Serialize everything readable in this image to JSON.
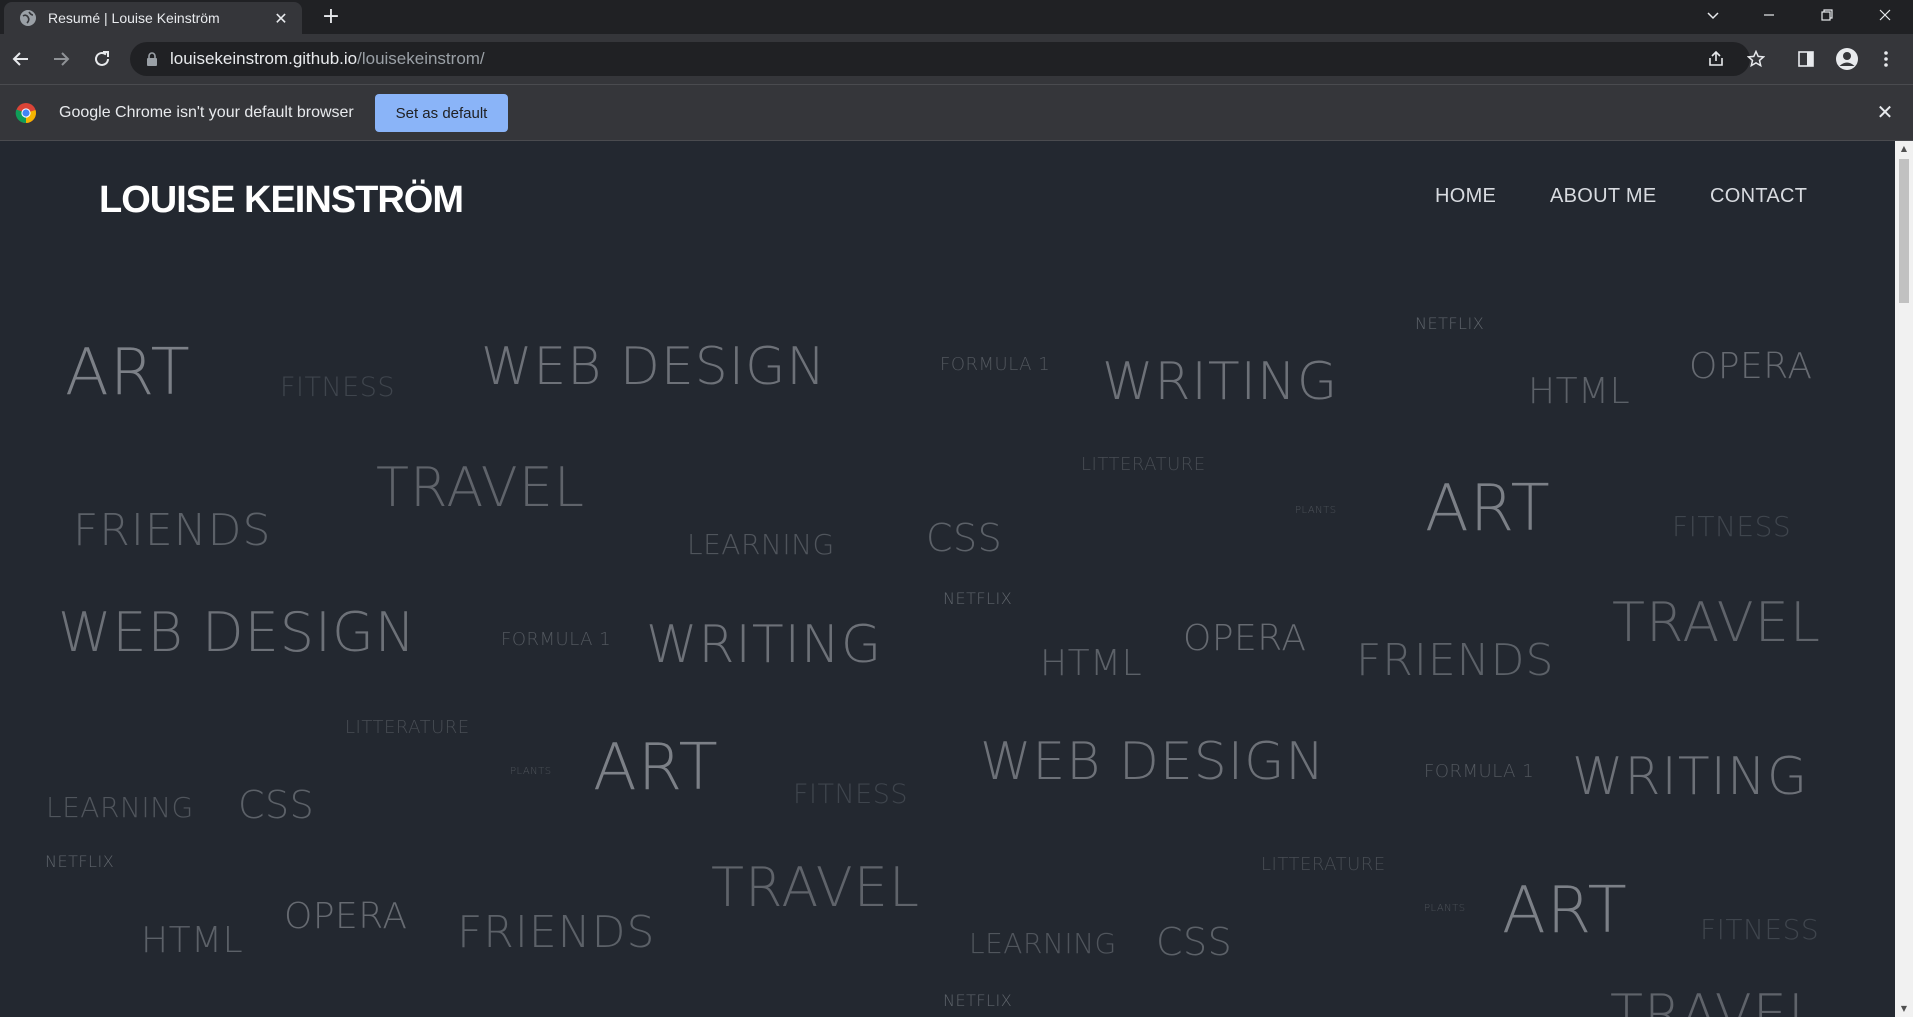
{
  "browser": {
    "tab_title": "Resumé | Louise Keinström",
    "url_host": "louisekeinstrom.github.io",
    "url_path": "/louisekeinstrom/"
  },
  "infobar": {
    "message": "Google Chrome isn't your default browser",
    "button_label": "Set as default"
  },
  "site": {
    "title": "LOUISE KEINSTRÖM",
    "nav": [
      "HOME",
      "ABOUT ME",
      "CONTACT"
    ]
  },
  "word_cloud": [
    {
      "text": "ART",
      "tone": "#7c8087"
    },
    {
      "text": "FITNESS",
      "tone": "#3f454d"
    },
    {
      "text": "WEB DESIGN",
      "tone": "#6d7178"
    },
    {
      "text": "FORMULA 1",
      "tone": "#52575e"
    },
    {
      "text": "WRITING",
      "tone": "#6d7178"
    },
    {
      "text": "NETFLIX",
      "tone": "#5f646b"
    },
    {
      "text": "OPERA",
      "tone": "#666a71"
    },
    {
      "text": "HTML",
      "tone": "#5c6168"
    },
    {
      "text": "TRAVEL",
      "tone": "#5f636a"
    },
    {
      "text": "LITTERATURE",
      "tone": "#484d54"
    },
    {
      "text": "FRIENDS",
      "tone": "#5c6168"
    },
    {
      "text": "LEARNING",
      "tone": "#50555c"
    },
    {
      "text": "CSS",
      "tone": "#5c6168"
    },
    {
      "text": "PLANTS",
      "tone": "#4d5259"
    },
    {
      "text": "ART",
      "tone": "#7c8087"
    },
    {
      "text": "FITNESS",
      "tone": "#3f454d"
    },
    {
      "text": "NETFLIX",
      "tone": "#5f646b"
    },
    {
      "text": "WEB DESIGN",
      "tone": "#6d7178"
    },
    {
      "text": "FORMULA 1",
      "tone": "#52575e"
    },
    {
      "text": "WRITING",
      "tone": "#6d7178"
    },
    {
      "text": "HTML",
      "tone": "#5c6168"
    },
    {
      "text": "OPERA",
      "tone": "#666a71"
    },
    {
      "text": "FRIENDS",
      "tone": "#5c6168"
    },
    {
      "text": "TRAVEL",
      "tone": "#5f636a"
    },
    {
      "text": "LITTERATURE",
      "tone": "#484d54"
    },
    {
      "text": "PLANTS",
      "tone": "#4d5259"
    },
    {
      "text": "ART",
      "tone": "#7c8087"
    },
    {
      "text": "FITNESS",
      "tone": "#3f454d"
    },
    {
      "text": "WEB DESIGN",
      "tone": "#6d7178"
    },
    {
      "text": "FORMULA 1",
      "tone": "#52575e"
    },
    {
      "text": "WRITING",
      "tone": "#6d7178"
    },
    {
      "text": "LEARNING",
      "tone": "#50555c"
    },
    {
      "text": "CSS",
      "tone": "#5c6168"
    },
    {
      "text": "NETFLIX",
      "tone": "#5f646b"
    },
    {
      "text": "TRAVEL",
      "tone": "#5f636a"
    },
    {
      "text": "LITTERATURE",
      "tone": "#484d54"
    },
    {
      "text": "OPERA",
      "tone": "#666a71"
    },
    {
      "text": "HTML",
      "tone": "#5c6168"
    },
    {
      "text": "FRIENDS",
      "tone": "#5c6168"
    },
    {
      "text": "PLANTS",
      "tone": "#4d5259"
    },
    {
      "text": "ART",
      "tone": "#7c8087"
    },
    {
      "text": "FITNESS",
      "tone": "#3f454d"
    },
    {
      "text": "LEARNING",
      "tone": "#50555c"
    },
    {
      "text": "CSS",
      "tone": "#5c6168"
    },
    {
      "text": "NETFLIX",
      "tone": "#5f646b"
    },
    {
      "text": "TRAVEL",
      "tone": "#5f636a"
    }
  ]
}
